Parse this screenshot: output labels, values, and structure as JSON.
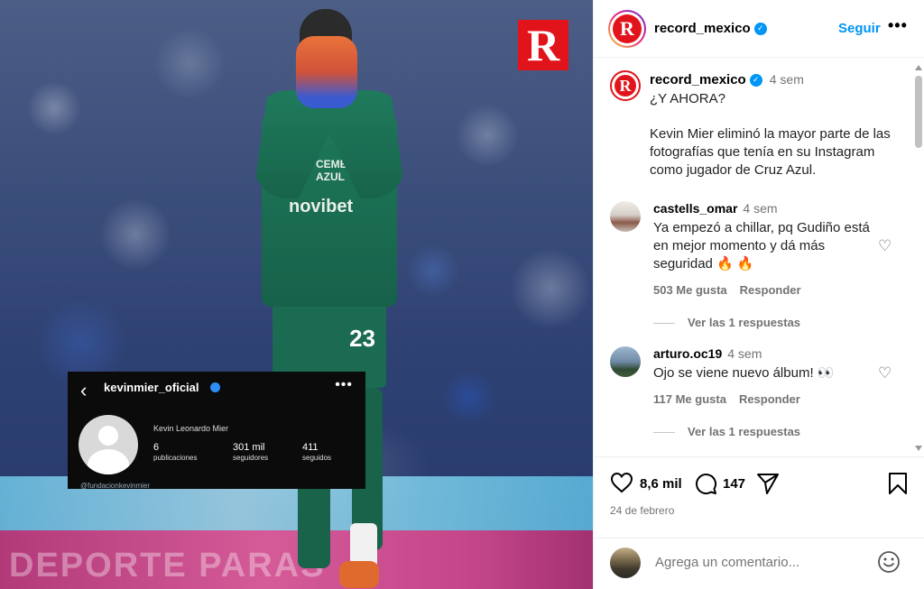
{
  "post_image": {
    "logo_letter": "R",
    "overlay": {
      "username": "kevinmier_oficial",
      "full_name": "Kevin Leonardo Mier",
      "stats": [
        {
          "value": "6",
          "label": "publicaciones"
        },
        {
          "value": "301 mil",
          "label": "seguidores"
        },
        {
          "value": "411",
          "label": "seguidos"
        }
      ],
      "link": "@fundacionkevinmier"
    },
    "jersey_sponsor": "novibet",
    "jersey_sponsor_top": "CEMEX CRUZ AZUL",
    "shirt_number": "23",
    "ad_board_text": "DEPORTE PARAS"
  },
  "header": {
    "username": "record_mexico",
    "follow_label": "Seguir",
    "more_label": "•••"
  },
  "caption": {
    "username": "record_mexico",
    "time": "4 sem",
    "line1": "¿Y AHORA?",
    "body": "Kevin Mier eliminó la mayor parte de las fotografías que tenía en su Instagram como jugador de Cruz Azul."
  },
  "comments": [
    {
      "username": "castells_omar",
      "time": "4 sem",
      "text": "Ya empezó a chillar, pq Gudiño está en mejor momento y dá más seguridad 🔥 🔥",
      "likes": "503 Me gusta",
      "reply": "Responder",
      "replies": "Ver las 1 respuestas"
    },
    {
      "username": "arturo.oc19",
      "time": "4 sem",
      "text": "Ojo se viene nuevo álbum! 👀",
      "likes": "117 Me gusta",
      "reply": "Responder",
      "replies": "Ver las 1 respuestas"
    }
  ],
  "actions": {
    "likes": "8,6 mil",
    "comments": "147",
    "date": "24 de febrero"
  },
  "composer": {
    "placeholder": "Agrega un comentario..."
  },
  "colors": {
    "accent_blue": "#0095f6",
    "brand_red": "#e2141b"
  },
  "icons": [
    "heart-icon",
    "comment-icon",
    "share-icon",
    "bookmark-icon",
    "emoji-icon",
    "verified-icon",
    "more-icon",
    "back-icon"
  ]
}
